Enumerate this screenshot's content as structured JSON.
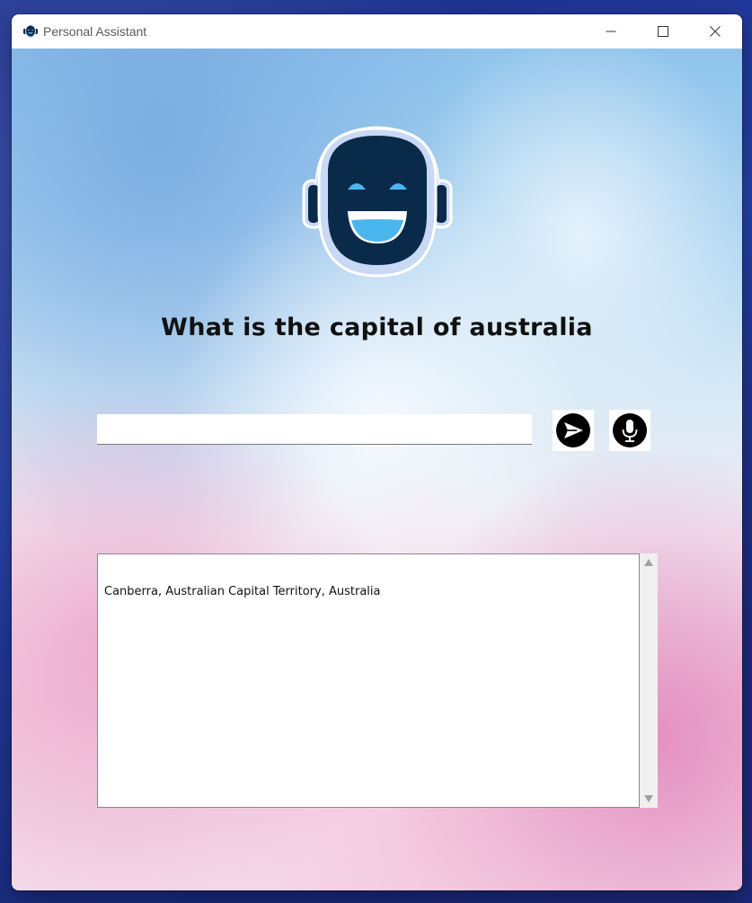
{
  "window": {
    "title": "Personal Assistant"
  },
  "main": {
    "question": "What is the capital of australia",
    "input": {
      "value": "",
      "placeholder": ""
    },
    "output": "Canberra, Australian Capital Territory, Australia"
  },
  "icons": {
    "app": "robot-icon",
    "logo": "robot-logo",
    "send": "send-icon",
    "mic": "microphone-icon"
  },
  "colors": {
    "robot_face": "#0a2a4a",
    "robot_eye": "#4ab6f0",
    "robot_outline": "#c9d9f5"
  }
}
